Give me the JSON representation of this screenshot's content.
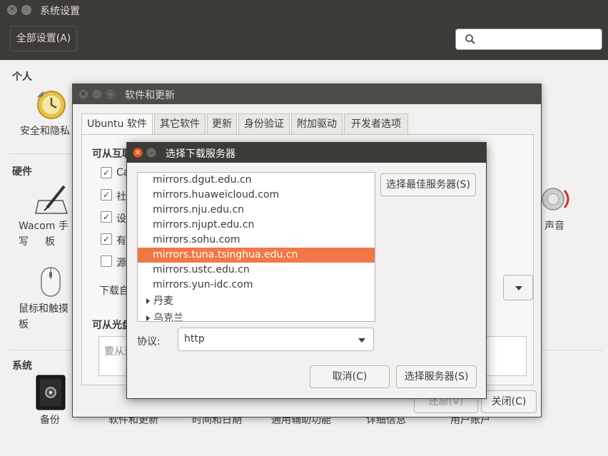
{
  "system_settings": {
    "title": "系统设置",
    "all_settings_label": "全部设置(A)",
    "search_placeholder": "",
    "sections": {
      "personal": "个人",
      "hardware": "硬件",
      "system": "系统"
    },
    "items": {
      "security": "安全和隐私",
      "wacom_line1": "Wacom 手写",
      "wacom_line2": "板",
      "mouse": "鼠标和触摸板",
      "sound": "声音",
      "backup": "备份",
      "software_updates": "软件和更新",
      "time_date": "时间和日期",
      "accessibility": "通用辅助功能",
      "details": "详细信息",
      "user_accounts": "用户账户"
    }
  },
  "software_updates": {
    "title": "软件和更新",
    "tabs": [
      "Ubuntu 软件",
      "其它软件",
      "更新",
      "身份验证",
      "附加驱动",
      "开发者选项"
    ],
    "internet_heading": "可从互联网下载",
    "checkboxes": [
      {
        "label": "Ca",
        "checked": true
      },
      {
        "label": "社",
        "checked": true
      },
      {
        "label": "设",
        "checked": true
      },
      {
        "label": "有",
        "checked": true
      },
      {
        "label": "源",
        "checked": false
      }
    ],
    "download_from_label": "下载自",
    "cdrom_heading": "可从光盘",
    "cdrom_placeholder": "要从光",
    "revert_label": "还原(V)",
    "close_label": "关闭(C)"
  },
  "choose_server": {
    "title": "选择下载服务器",
    "servers": [
      "mirrors.dgut.edu.cn",
      "mirrors.huaweicloud.com",
      "mirrors.nju.edu.cn",
      "mirrors.njupt.edu.cn",
      "mirrors.sohu.com",
      "mirrors.tuna.tsinghua.edu.cn",
      "mirrors.ustc.edu.cn",
      "mirrors.yun-idc.com"
    ],
    "selected_server": "mirrors.tuna.tsinghua.edu.cn",
    "countries": [
      "丹麦",
      "乌克兰"
    ],
    "best_server_label": "选择最佳服务器(S)",
    "protocol_label": "协议:",
    "protocol_value": "http",
    "cancel_label": "取消(C)",
    "choose_label": "选择服务器(S)"
  }
}
